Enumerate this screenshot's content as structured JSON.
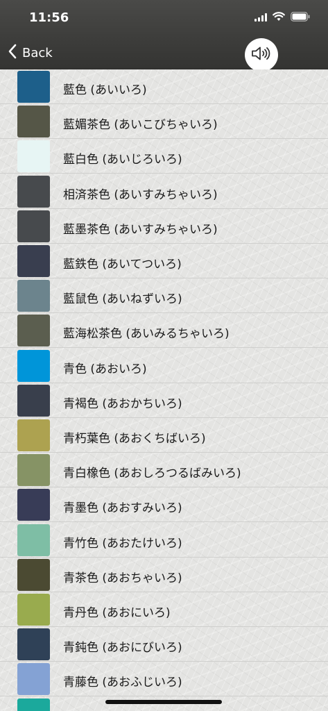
{
  "status": {
    "time": "11:56"
  },
  "nav": {
    "back_label": "Back"
  },
  "colors": [
    {
      "label": "藍色 (あいいろ)",
      "color": "#1d5f8a"
    },
    {
      "label": "藍媚茶色 (あいこびちゃいろ)",
      "color": "#555647"
    },
    {
      "label": "藍白色 (あいじろいろ)",
      "color": "#e7f5f4"
    },
    {
      "label": "相済茶色 (あいすみちゃいろ)",
      "color": "#474a4d"
    },
    {
      "label": "藍墨茶色 (あいすみちゃいろ)",
      "color": "#474a4d"
    },
    {
      "label": "藍鉄色 (あいてついろ)",
      "color": "#393e4f"
    },
    {
      "label": "藍鼠色 (あいねずいろ)",
      "color": "#6c848d"
    },
    {
      "label": "藍海松茶色 (あいみるちゃいろ)",
      "color": "#5b5e4f"
    },
    {
      "label": "青色 (あおいろ)",
      "color": "#0095d9"
    },
    {
      "label": "青褐色 (あおかちいろ)",
      "color": "#393f4c"
    },
    {
      "label": "青朽葉色 (あおくちばいろ)",
      "color": "#ada250"
    },
    {
      "label": "青白橡色 (あおしろつるばみいろ)",
      "color": "#869365"
    },
    {
      "label": "青墨色 (あおすみいろ)",
      "color": "#383c57"
    },
    {
      "label": "青竹色 (あおたけいろ)",
      "color": "#7ebea5"
    },
    {
      "label": "青茶色 (あおちゃいろ)",
      "color": "#4b4a32"
    },
    {
      "label": "青丹色 (あおにいろ)",
      "color": "#99ab4e"
    },
    {
      "label": "青鈍色 (あおにびいろ)",
      "color": "#2f4157"
    },
    {
      "label": "青藤色 (あおふじいろ)",
      "color": "#84a2d4"
    },
    {
      "label": "",
      "color": "#1ba99c"
    }
  ]
}
